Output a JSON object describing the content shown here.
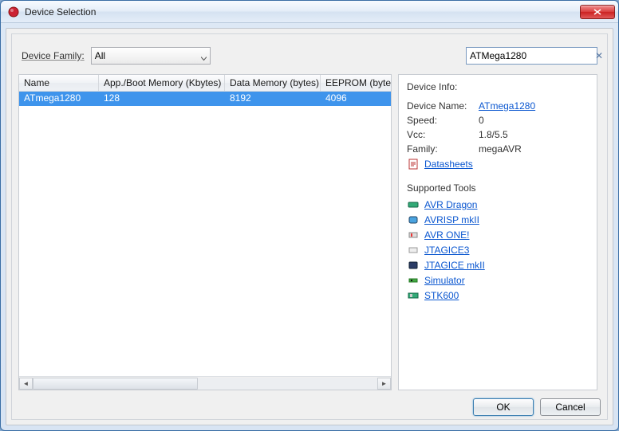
{
  "window": {
    "title": "Device Selection"
  },
  "toolbar": {
    "family_label": "Device Family:",
    "family_value": "All",
    "search_value": "ATMega1280"
  },
  "table": {
    "columns": {
      "name": "Name",
      "app": "App./Boot Memory (Kbytes)",
      "data": "Data Memory (bytes)",
      "eeprom": "EEPROM (bytes)"
    },
    "rows": [
      {
        "name": "ATmega1280",
        "app": "128",
        "data": "8192",
        "eeprom": "4096",
        "selected": true
      }
    ]
  },
  "info": {
    "title": "Device Info:",
    "device_name_label": "Device Name:",
    "device_name_value": "ATmega1280",
    "speed_label": "Speed:",
    "speed_value": "0",
    "vcc_label": "Vcc:",
    "vcc_value": "1.8/5.5",
    "family_label": "Family:",
    "family_value": "megaAVR",
    "datasheets_label": "Datasheets",
    "supported_tools_label": "Supported Tools",
    "tools": [
      {
        "name": "AVR Dragon",
        "icon": "dragon"
      },
      {
        "name": "AVRISP mkII",
        "icon": "avrisp"
      },
      {
        "name": "AVR ONE!",
        "icon": "avrone"
      },
      {
        "name": "JTAGICE3",
        "icon": "jtagice3"
      },
      {
        "name": "JTAGICE mkII",
        "icon": "jtagicemk2"
      },
      {
        "name": "Simulator",
        "icon": "sim"
      },
      {
        "name": "STK600",
        "icon": "stk600"
      }
    ]
  },
  "buttons": {
    "ok": "OK",
    "cancel": "Cancel"
  }
}
